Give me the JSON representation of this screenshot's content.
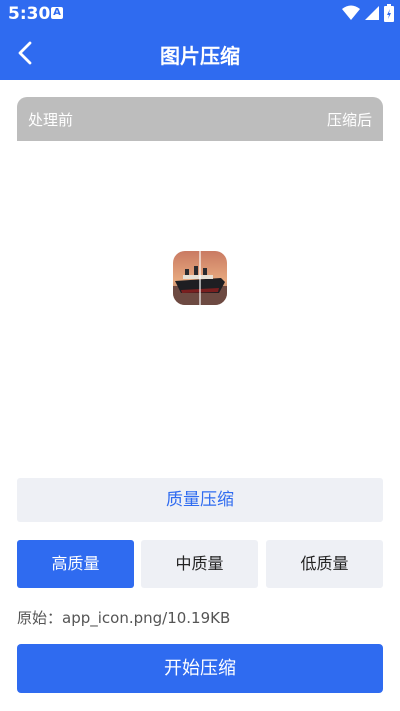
{
  "status_bar": {
    "time": "5:30",
    "notification_icon": "A"
  },
  "nav": {
    "title": "图片压缩",
    "back_icon": "chevron-left-icon"
  },
  "preview": {
    "before_label": "处理前",
    "after_label": "压缩后"
  },
  "compress_mode": {
    "label": "质量压缩"
  },
  "quality_options": [
    {
      "label": "高质量",
      "selected": true
    },
    {
      "label": "中质量",
      "selected": false
    },
    {
      "label": "低质量",
      "selected": false
    }
  ],
  "original_info": "原始：app_icon.png/10.19KB",
  "start_button": "开始压缩",
  "colors": {
    "primary": "#2f6bf0",
    "preview_bar": "#bdbdbd",
    "option_bg": "#eef0f5"
  }
}
